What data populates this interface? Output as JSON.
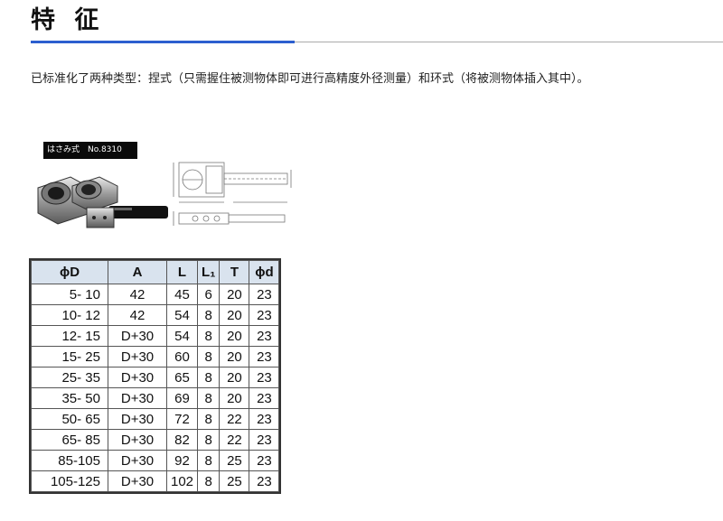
{
  "page": {
    "title": "特 征",
    "description": "已标准化了两种类型：捏式（只需握住被测物体即可进行高精度外径测量）和环式（将被测物体插入其中）。"
  },
  "image": {
    "label": "はさみ式　No.8310"
  },
  "table": {
    "headers": [
      "ϕD",
      "A",
      "L",
      "L₁",
      "T",
      "ϕd"
    ],
    "rows": [
      [
        "5-  10",
        "42",
        "45",
        "6",
        "20",
        "23"
      ],
      [
        "10-  12",
        "42",
        "54",
        "8",
        "20",
        "23"
      ],
      [
        "12-  15",
        "D+30",
        "54",
        "8",
        "20",
        "23"
      ],
      [
        "15-  25",
        "D+30",
        "60",
        "8",
        "20",
        "23"
      ],
      [
        "25-  35",
        "D+30",
        "65",
        "8",
        "20",
        "23"
      ],
      [
        "35-  50",
        "D+30",
        "69",
        "8",
        "20",
        "23"
      ],
      [
        "50-  65",
        "D+30",
        "72",
        "8",
        "22",
        "23"
      ],
      [
        "65-  85",
        "D+30",
        "82",
        "8",
        "22",
        "23"
      ],
      [
        "85-105",
        "D+30",
        "92",
        "8",
        "25",
        "23"
      ],
      [
        "105-125",
        "D+30",
        "102",
        "8",
        "25",
        "23"
      ]
    ]
  }
}
